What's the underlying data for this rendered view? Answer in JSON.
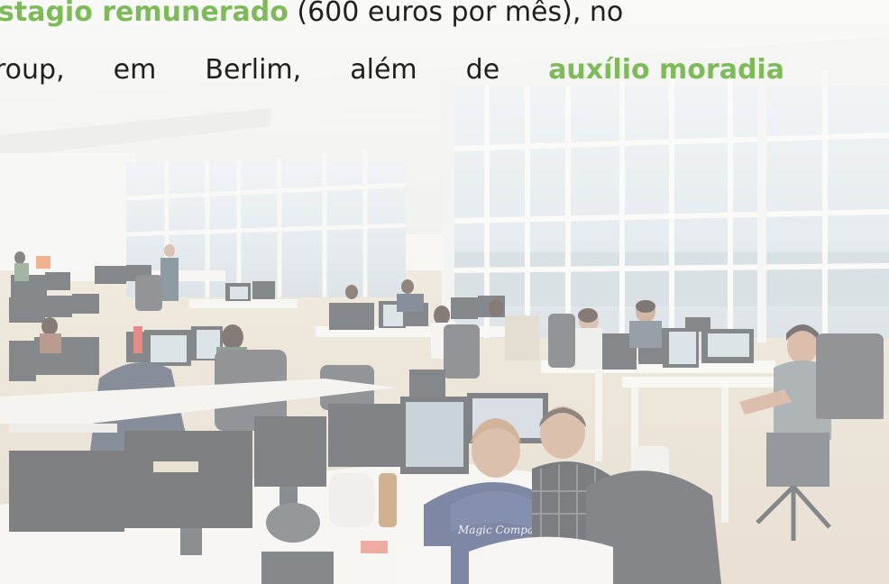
{
  "caption": {
    "line1": {
      "highlight": "stagio remunerado",
      "text": "(600 euros por mês), no"
    },
    "line2": {
      "w1": "roup,",
      "w2": "em",
      "w3": "Berlim,",
      "w4": "além",
      "w5": "de",
      "highlight": "auxílio moradia"
    }
  },
  "photo": {
    "shirt_print": "Magic Company"
  },
  "colors": {
    "highlight": "#7dba58",
    "text": "#1f1f1f"
  }
}
